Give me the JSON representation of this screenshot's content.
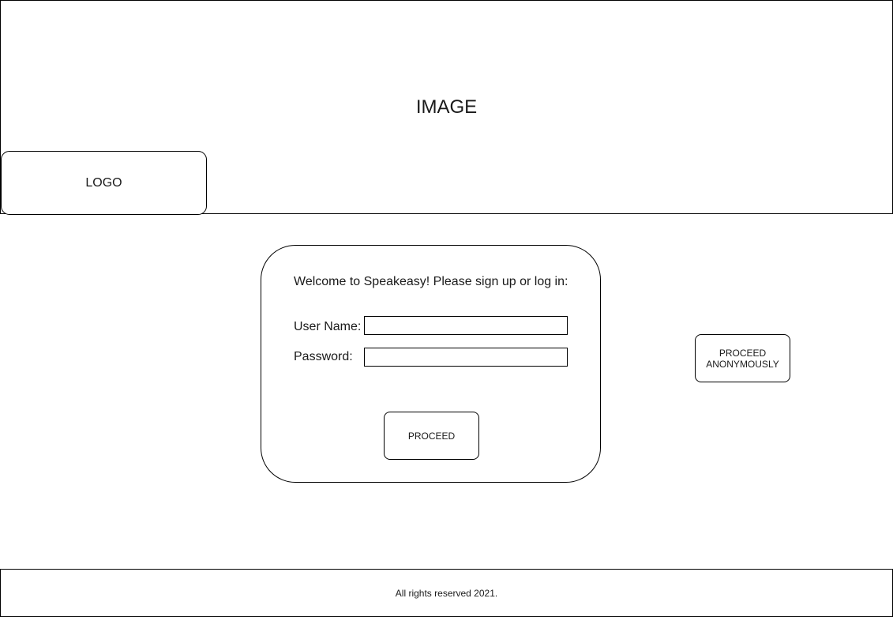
{
  "header": {
    "image_label": "IMAGE",
    "logo_label": "LOGO"
  },
  "login": {
    "welcome_text": "Welcome to Speakeasy! Please sign up or log in:",
    "username_label": "User Name:",
    "username_value": "",
    "password_label": "Password:",
    "password_value": "",
    "proceed_label": "PROCEED"
  },
  "anonymous": {
    "proceed_label": "PROCEED\nANONYMOUSLY"
  },
  "footer": {
    "text": "All rights reserved 2021."
  }
}
